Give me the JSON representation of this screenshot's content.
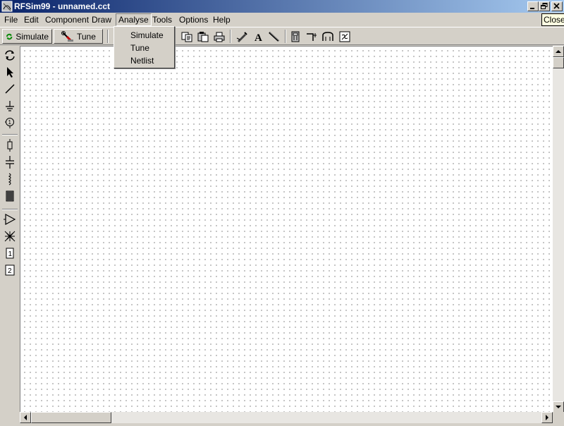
{
  "window": {
    "title": "RFSim99 - unnamed.cct",
    "tooltip": "Close"
  },
  "menubar": {
    "items": [
      {
        "label": "File"
      },
      {
        "label": "Edit"
      },
      {
        "label": "Component"
      },
      {
        "label": "Draw"
      },
      {
        "label": "Analyse"
      },
      {
        "label": "Tools"
      },
      {
        "label": "Options"
      },
      {
        "label": "Help"
      }
    ]
  },
  "toolbar": {
    "simulate_label": "Simulate",
    "tune_label": "Tune"
  },
  "dropdown": {
    "items": [
      {
        "label": "Simulate"
      },
      {
        "label": "Tune"
      },
      {
        "label": "Netlist"
      }
    ]
  },
  "palette": {
    "icons": [
      "rotate-icon",
      "pointer-icon",
      "wire-icon",
      "ground-icon",
      "port-icon",
      "resistor-icon",
      "capacitor-icon",
      "inductor-icon",
      "transformer-icon",
      "amplifier-icon",
      "coupler-icon",
      "one-port-icon",
      "two-port-icon"
    ]
  },
  "colors": {
    "title_gradient_start": "#0a246a",
    "title_gradient_end": "#a6caf0",
    "face": "#d4d0c8",
    "canvas": "#ffffff"
  }
}
